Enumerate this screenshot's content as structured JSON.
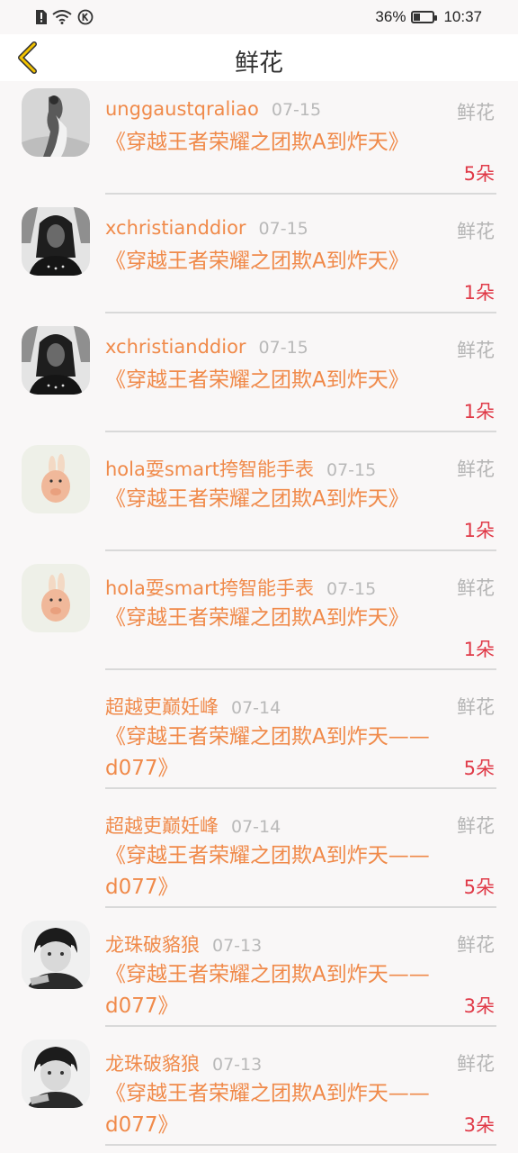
{
  "status_bar": {
    "battery": "36%",
    "battery_level": 0.36,
    "time": "10:37",
    "icons": [
      "alert-sim-icon",
      "wifi-icon",
      "k-badge-icon",
      "battery-icon"
    ]
  },
  "header": {
    "title": "鲜花",
    "back_icon": "chevron-left-icon",
    "accent": "#f2c200"
  },
  "colors": {
    "username": "#f08a4a",
    "count": "#e03a48",
    "muted": "#b9b9b9"
  },
  "items": [
    {
      "user": "unggaustqraliao",
      "date": "07-15",
      "type": "鲜花",
      "book": "《穿越王者荣耀之团欺A到炸天》",
      "count": "5朵",
      "avatar": "dancer"
    },
    {
      "user": "xchristianddior",
      "date": "07-15",
      "type": "鲜花",
      "book": "《穿越王者荣耀之团欺A到炸天》",
      "count": "1朵",
      "avatar": "braids"
    },
    {
      "user": "xchristianddior",
      "date": "07-15",
      "type": "鲜花",
      "book": "《穿越王者荣耀之团欺A到炸天》",
      "count": "1朵",
      "avatar": "braids"
    },
    {
      "user": "hola耍smart挎智能手表",
      "date": "07-15",
      "type": "鲜花",
      "book": "《穿越王者荣耀之团欺A到炸天》",
      "count": "1朵",
      "avatar": "rabbit"
    },
    {
      "user": "hola耍smart挎智能手表",
      "date": "07-15",
      "type": "鲜花",
      "book": "《穿越王者荣耀之团欺A到炸天》",
      "count": "1朵",
      "avatar": "rabbit"
    },
    {
      "user": "超越吏巅妊峰",
      "date": "07-14",
      "type": "鲜花",
      "book": "《穿越王者荣耀之团欺A到炸天——d077》",
      "count": "5朵",
      "avatar": "none"
    },
    {
      "user": "超越吏巅妊峰",
      "date": "07-14",
      "type": "鲜花",
      "book": "《穿越王者荣耀之团欺A到炸天——d077》",
      "count": "5朵",
      "avatar": "none"
    },
    {
      "user": "龙珠破貉狼",
      "date": "07-13",
      "type": "鲜花",
      "book": "《穿越王者荣耀之团欺A到炸天——d077》",
      "count": "3朵",
      "avatar": "boy"
    },
    {
      "user": "龙珠破貉狼",
      "date": "07-13",
      "type": "鲜花",
      "book": "《穿越王者荣耀之团欺A到炸天——d077》",
      "count": "3朵",
      "avatar": "boy"
    }
  ]
}
